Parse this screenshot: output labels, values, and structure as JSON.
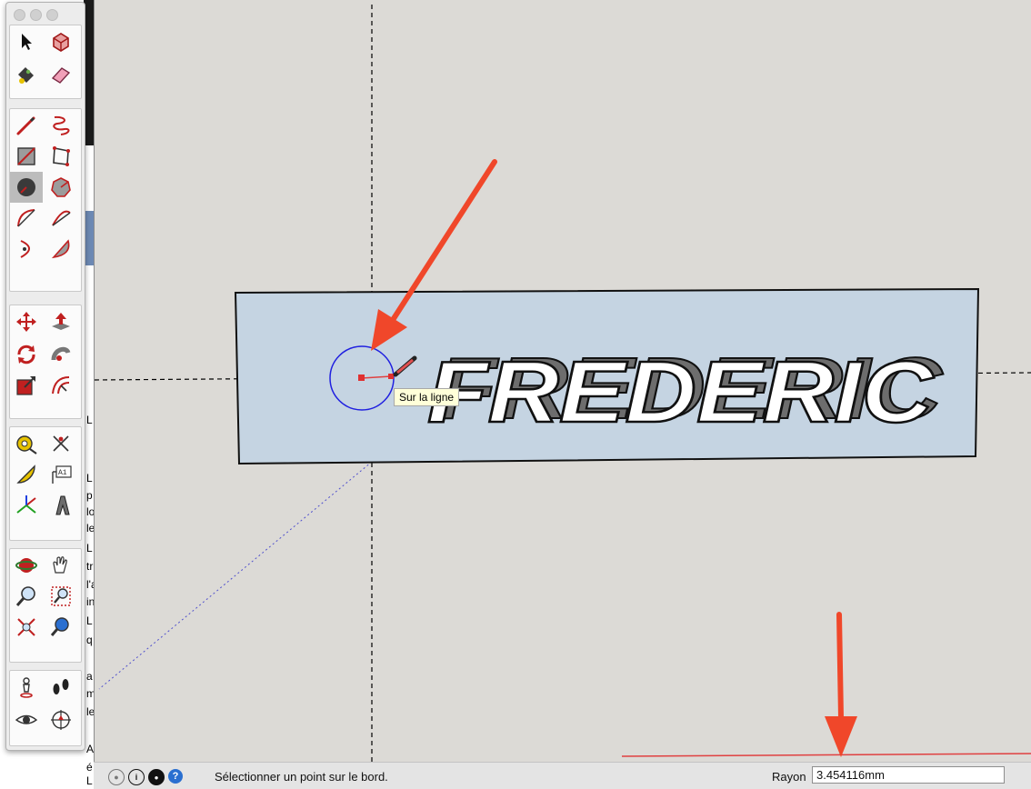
{
  "background_window": {
    "letters": [
      "L",
      "L",
      "p",
      "lo",
      "le",
      "L",
      "tr",
      "l'a",
      "in",
      "L",
      "q",
      "a",
      "m",
      "le",
      "A",
      "é",
      "L"
    ]
  },
  "palette": {
    "tools": [
      {
        "name": "select-tool",
        "icon": "arrow-icon"
      },
      {
        "name": "make-component-tool",
        "icon": "component-icon"
      },
      {
        "name": "paint-bucket-tool",
        "icon": "paint-bucket-icon"
      },
      {
        "name": "eraser-tool",
        "icon": "eraser-icon"
      },
      {
        "name": "line-tool",
        "icon": "pencil-icon"
      },
      {
        "name": "freehand-tool",
        "icon": "freehand-icon"
      },
      {
        "name": "rectangle-tool",
        "icon": "rectangle-icon"
      },
      {
        "name": "rotated-rectangle-tool",
        "icon": "rotated-rectangle-icon"
      },
      {
        "name": "circle-tool",
        "icon": "circle-icon",
        "active": true
      },
      {
        "name": "polygon-tool",
        "icon": "polygon-icon"
      },
      {
        "name": "arc-tool",
        "icon": "arc-icon"
      },
      {
        "name": "two-point-arc-tool",
        "icon": "two-point-arc-icon"
      },
      {
        "name": "three-point-arc-tool",
        "icon": "three-point-arc-icon"
      },
      {
        "name": "pie-tool",
        "icon": "pie-icon"
      },
      {
        "name": "move-tool",
        "icon": "move-icon"
      },
      {
        "name": "push-pull-tool",
        "icon": "push-pull-icon"
      },
      {
        "name": "rotate-tool",
        "icon": "rotate-icon"
      },
      {
        "name": "follow-me-tool",
        "icon": "follow-me-icon"
      },
      {
        "name": "scale-tool",
        "icon": "scale-icon"
      },
      {
        "name": "offset-tool",
        "icon": "offset-icon"
      },
      {
        "name": "tape-measure-tool",
        "icon": "tape-measure-icon"
      },
      {
        "name": "dimension-tool",
        "icon": "dimension-icon"
      },
      {
        "name": "protractor-tool",
        "icon": "protractor-icon"
      },
      {
        "name": "text-tool",
        "icon": "text-icon",
        "label": "A1"
      },
      {
        "name": "axes-tool",
        "icon": "axes-icon"
      },
      {
        "name": "3d-text-tool",
        "icon": "3d-text-icon"
      },
      {
        "name": "orbit-tool",
        "icon": "orbit-icon"
      },
      {
        "name": "pan-tool",
        "icon": "pan-icon"
      },
      {
        "name": "zoom-tool",
        "icon": "zoom-icon"
      },
      {
        "name": "zoom-window-tool",
        "icon": "zoom-window-icon"
      },
      {
        "name": "zoom-extents-tool",
        "icon": "zoom-extents-icon"
      },
      {
        "name": "previous-view-tool",
        "icon": "previous-view-icon"
      },
      {
        "name": "position-camera-tool",
        "icon": "position-camera-icon"
      },
      {
        "name": "walk-tool",
        "icon": "footprints-icon"
      },
      {
        "name": "look-around-tool",
        "icon": "eye-icon"
      },
      {
        "name": "section-plane-tool",
        "icon": "section-plane-icon"
      }
    ]
  },
  "viewport": {
    "model_text": "FREDERIC",
    "tooltip": "Sur la ligne",
    "colors": {
      "plate": "#c5d4e2",
      "arrow": "#f0472a",
      "circle": "#2020e0",
      "axis_red": "#e04040"
    }
  },
  "statusbar": {
    "icons": [
      "geo-location-icon",
      "credits-icon",
      "account-icon",
      "help-icon"
    ],
    "help_glyph": "?",
    "message": "Sélectionner un point sur le bord.",
    "measure_label": "Rayon",
    "measure_value": "3.454116mm"
  }
}
